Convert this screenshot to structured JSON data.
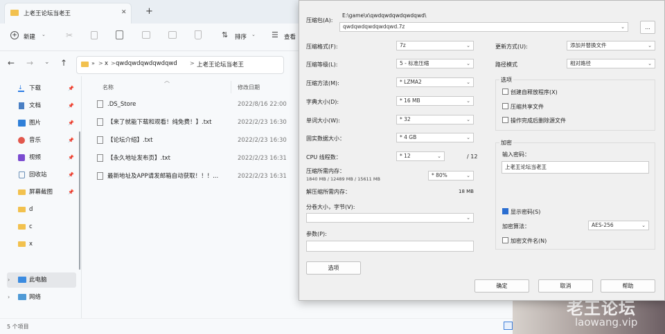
{
  "explorer": {
    "tab_title": "上老王论坛当老王",
    "new_tab_symbol": "+",
    "close_symbol": "✕",
    "toolbar": {
      "new_label": "新建",
      "sort_label": "排序",
      "view_label": "查看"
    },
    "address": {
      "overflow": "»",
      "path": [
        "x",
        "qwdqwdqwdqwdqwd",
        "上老王论坛当老王"
      ],
      "sep": ">"
    },
    "nav_items": [
      {
        "label": "下载",
        "icon": "download-icon",
        "pinned": true
      },
      {
        "label": "文档",
        "icon": "document-icon",
        "pinned": true
      },
      {
        "label": "图片",
        "icon": "pictures-icon",
        "pinned": true
      },
      {
        "label": "音乐",
        "icon": "music-icon",
        "pinned": true
      },
      {
        "label": "视频",
        "icon": "video-icon",
        "pinned": true
      },
      {
        "label": "回收站",
        "icon": "recycle-bin-icon",
        "pinned": true
      },
      {
        "label": "屏幕截图",
        "icon": "folder-icon",
        "pinned": true
      },
      {
        "label": "d",
        "icon": "folder-icon",
        "pinned": false
      },
      {
        "label": "c",
        "icon": "folder-icon",
        "pinned": false
      },
      {
        "label": "x",
        "icon": "folder-icon",
        "pinned": false
      }
    ],
    "tree_items": [
      {
        "label": "此电脑",
        "icon": "computer-icon"
      },
      {
        "label": "网络",
        "icon": "network-icon"
      }
    ],
    "columns": {
      "name": "名称",
      "date": "修改日期"
    },
    "files": [
      {
        "name": ".DS_Store",
        "date": "2022/8/16 22:00"
      },
      {
        "name": "【来了就能下载和观看！纯免费！】.txt",
        "date": "2022/2/23 16:30"
      },
      {
        "name": "【论坛介绍】.txt",
        "date": "2022/2/23 16:30"
      },
      {
        "name": "【永久地址发布页】.txt",
        "date": "2022/2/23 16:31"
      },
      {
        "name": "最新地址及APP请发邮箱自动获取！！！...",
        "date": "2022/2/23 16:31"
      }
    ],
    "status": "5 个项目"
  },
  "dialog": {
    "archive_label": "压缩包(A):",
    "archive_dir": "E:\\game\\x\\qwdqwdqwdqwdqwd\\",
    "archive_name": "qwdqwdqwdqwdqwd.7z",
    "browse": "...",
    "left": [
      {
        "label": "压缩格式(F):",
        "value": "7z"
      },
      {
        "label": "压缩等级(L):",
        "value": "5 - 标准压缩"
      },
      {
        "label": "压缩方法(M):",
        "value": "* LZMA2"
      },
      {
        "label": "字典大小(D):",
        "value": "* 16 MB"
      },
      {
        "label": "单词大小(W):",
        "value": "* 32"
      },
      {
        "label": "固实数据大小：",
        "value": "* 4 GB"
      },
      {
        "label": "CPU 线程数：",
        "value": "* 12",
        "extra": "/ 12"
      }
    ],
    "mem_label": "压缩所需内存：",
    "mem_detail": "1840 MB / 12489 MB / 15611 MB",
    "mem_pct": "* 80%",
    "decomp_label": "解压缩所需内存：",
    "decomp_value": "18 MB",
    "split_label": "分卷大小，字节(V):",
    "params_label": "参数(P):",
    "options_button": "选项",
    "update_label": "更新方式(U):",
    "update_value": "添加并替换文件",
    "path_label": "路径模式",
    "path_value": "相对路径",
    "options_group": "选项",
    "checks": [
      {
        "label": "创建自释放程序(X)",
        "checked": false
      },
      {
        "label": "压缩共享文件",
        "checked": false
      },
      {
        "label": "操作完成后删除源文件",
        "checked": false
      }
    ],
    "encrypt_group": "加密",
    "password_label": "输入密码：",
    "password_value": "上老王论坛当老王",
    "show_password": {
      "label": "显示密码(S)",
      "checked": true
    },
    "enc_method_label": "加密算法：",
    "enc_method_value": "AES-256",
    "encrypt_names": {
      "label": "加密文件名(N)",
      "checked": false
    },
    "ok": "确定",
    "cancel": "取消",
    "help": "帮助"
  },
  "watermark": {
    "title": "老王论坛",
    "url": "laowang.vip"
  },
  "colors": {
    "accent": "#2b6ed1",
    "folder": "#f2c14e"
  }
}
